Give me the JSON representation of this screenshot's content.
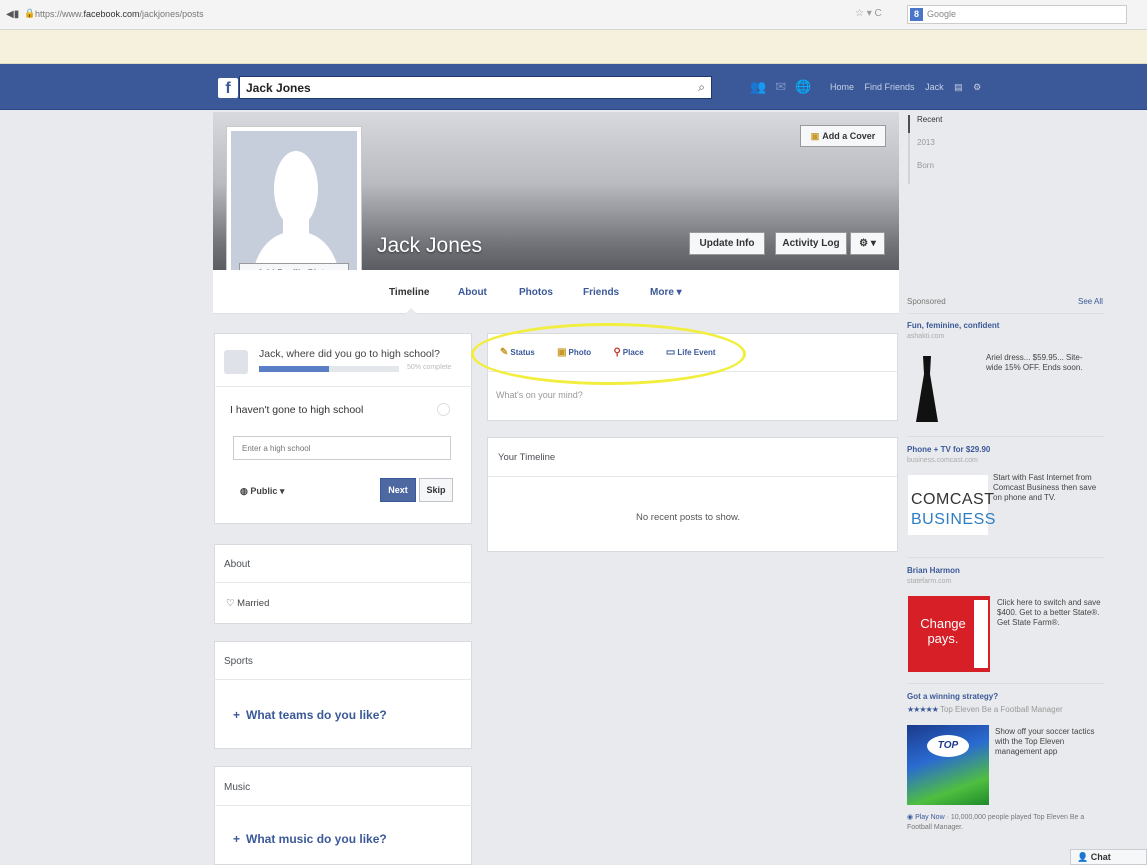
{
  "browser": {
    "url_prefix": "https://www.",
    "url_domain": "facebook.com",
    "url_path": "/jackjones/posts",
    "search_placeholder": "Google",
    "search_engine_letter": "8"
  },
  "topbar": {
    "logo": "f",
    "search_value": "Jack Jones",
    "nav": [
      "Home",
      "Find Friends",
      "Jack"
    ]
  },
  "profile": {
    "name": "Jack Jones",
    "add_profile_picture": "+ Add Profile Picture",
    "add_cover": "Add a Cover",
    "update_info": "Update Info",
    "activity_log": "Activity Log",
    "tabs": [
      "Timeline",
      "About",
      "Photos",
      "Friends",
      "More ▾"
    ]
  },
  "highschool": {
    "question": "Jack, where did you go to high school?",
    "progress": 0.5,
    "progress_text": "50% complete",
    "option": "I haven't gone to high school",
    "input_placeholder": "Enter a high school",
    "privacy": "Public ▾",
    "next": "Next",
    "skip": "Skip"
  },
  "about": {
    "title": "About",
    "status": "Married"
  },
  "sports": {
    "title": "Sports",
    "prompt": "What teams do you like?"
  },
  "music": {
    "title": "Music",
    "prompt": "What music do you like?"
  },
  "composer": {
    "tabs": [
      "Status",
      "Photo",
      "Place",
      "Life Event"
    ],
    "placeholder": "What's on your mind?"
  },
  "timeline": {
    "title": "Your Timeline",
    "empty": "No recent posts to show."
  },
  "years": [
    "Recent",
    "2013",
    "Born"
  ],
  "sponsored": {
    "label": "Sponsored",
    "see_all": "See All",
    "ads": [
      {
        "title": "Fun, feminine, confident",
        "url": "ashakti.com",
        "text": "Ariel dress... $59.95... Site-wide 15% OFF. Ends soon."
      },
      {
        "title": "Phone + TV for $29.90",
        "url": "business.comcast.com",
        "text": "Start with Fast Internet from Comcast Business then save on phone and TV.",
        "brand1": "COMCAST",
        "brand2": "BUSINESS"
      },
      {
        "title": "Brian Harmon",
        "url": "statefarm.com",
        "text": "Click here to switch and save $400. Get to a better State®. Get State Farm®.",
        "brand": "Change pays."
      },
      {
        "title": "Got a winning strategy?",
        "stars": "★★★★★",
        "url": "Top Eleven Be a Football Manager",
        "text": "Show off your soccer tactics with the Top Eleven management app",
        "brand": "TOP",
        "footer_link": "Play Now",
        "footer": " · 10,000,000 people played Top Eleven Be a Football Manager."
      }
    ]
  },
  "chat": "Chat"
}
